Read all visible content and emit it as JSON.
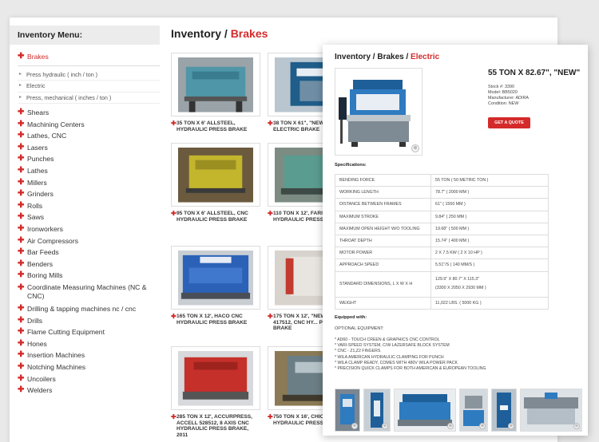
{
  "sidebar": {
    "title": "Inventory Menu:",
    "active_item": "Brakes",
    "subitems": [
      "Press hydraulic ( inch / ton )",
      "Electric",
      "Press, mechanical ( inches / ton )"
    ],
    "items": [
      "Shears",
      "Machining Centers",
      "Lathes, CNC",
      "Lasers",
      "Punches",
      "Lathes",
      "Millers",
      "Grinders",
      "Rolls",
      "Saws",
      "Ironworkers",
      "Air Compressors",
      "Bar Feeds",
      "Benders",
      "Boring Mills",
      "Coordinate Measuring Machines (NC & CNC)",
      "Drilling & tapping machines nc / cnc",
      "Drills",
      "Flame Cutting Equipment",
      "Hones",
      "Insertion Machines",
      "Notching Machines",
      "Uncoilers",
      "Welders"
    ]
  },
  "back_page": {
    "title_prefix": "Inventory / ",
    "title_section": "Brakes",
    "cards": [
      "35 TON X 6' ALLSTEEL, HYDRAULIC PRESS BRAKE",
      "38 TON X 61\", \"NEW\" ... ELECTRIC BRAKE",
      "95 TON X 6' ALLSTEEL, CNC HYDRAULIC PRESS BRAKE",
      "110 TON X 12', FARIN... HYDRAULIC PRESS BRAKE",
      "165 TON X 12', HACO CNC HYDRAULIC PRESS BRAKE",
      "175 TON X 12', \"NEW\" ... EDGE 417512, CNC HY... PRESS BRAKE",
      "285 TON X 12', ACCURPRESS, ACCELL 528512, 8 AXIS CNC HYDRAULIC PRESS BRAKE, 2011",
      "750 TON X 16', CHICA... HYDRAULIC PRESS BRAKE"
    ]
  },
  "front_page": {
    "title_prefix": "Inventory / Brakes / ",
    "title_section": "Electric",
    "product_title": "55 TON X 82.67\", \"NEW\"",
    "stock": "Stock #: 3390",
    "model": "Model: BB5020",
    "manufacturer": "Manufacturer: ADIRA",
    "condition": "Condition: NEW",
    "quote_button": "GET A QUOTE",
    "specs_label": "Specifications:",
    "specs": [
      {
        "k": "BENDING FORCE",
        "v": "55 TON ( 50 METRIC TON )"
      },
      {
        "k": "WORKING LENGTH",
        "v": "78.7\" ( 2000 MM )"
      },
      {
        "k": "DISTANCE BETWEEN FRAMES",
        "v": "61\" ( 1550 MM )"
      },
      {
        "k": "MAXIMUM STROKE",
        "v": "9.84\" ( 250 MM )"
      },
      {
        "k": "MAXIMUM OPEN HEIGHT W/O TOOLING",
        "v": "19.68\" ( 500 MM )"
      },
      {
        "k": "THROAT DEPTH",
        "v": "15.74\" ( 400 MM )"
      },
      {
        "k": "MOTOR POWER",
        "v": "2 X 7.5 KW ( 2 X 10 HP )"
      },
      {
        "k": "APPROACH SPEED",
        "v": "5.51\"/S ( 140 MM/S )"
      },
      {
        "k": "STANDARD DIMENSIONS, L X W X H",
        "v": "129.9\" X 80.7\" X 115.3\"",
        "v2": "(3300 X 2050 X 2930 MM )"
      },
      {
        "k": "WEIGHT",
        "v": "11,022 LBS. ( 5000 KG )"
      }
    ],
    "equipped_label": "Equipped with:",
    "optional_label": "OPTIONAL EQUIPMENT:",
    "equipment": [
      "* AD60 - TOUCH CREEN & GRAPHICS CNC CONTROL",
      "* VARI-SPEED SYSTEM, C/W LAZERSAFE BLOCK SYSTEM",
      "* CNC - Z1,Z2 FINGERS",
      "* WILA AMERICAN HYDRAULIC CLAMPING FOR PUNCH",
      "* WILA CLAMP READY, COMES WITH 480V WILA POWER PACK",
      "* PRECISION QUICK CLAMPS FOR BOTH AMERICAN & EUROPEAN TOOLING"
    ]
  },
  "icons": {
    "plus": "✚",
    "arrow": "▸",
    "zoom": "⊕"
  }
}
